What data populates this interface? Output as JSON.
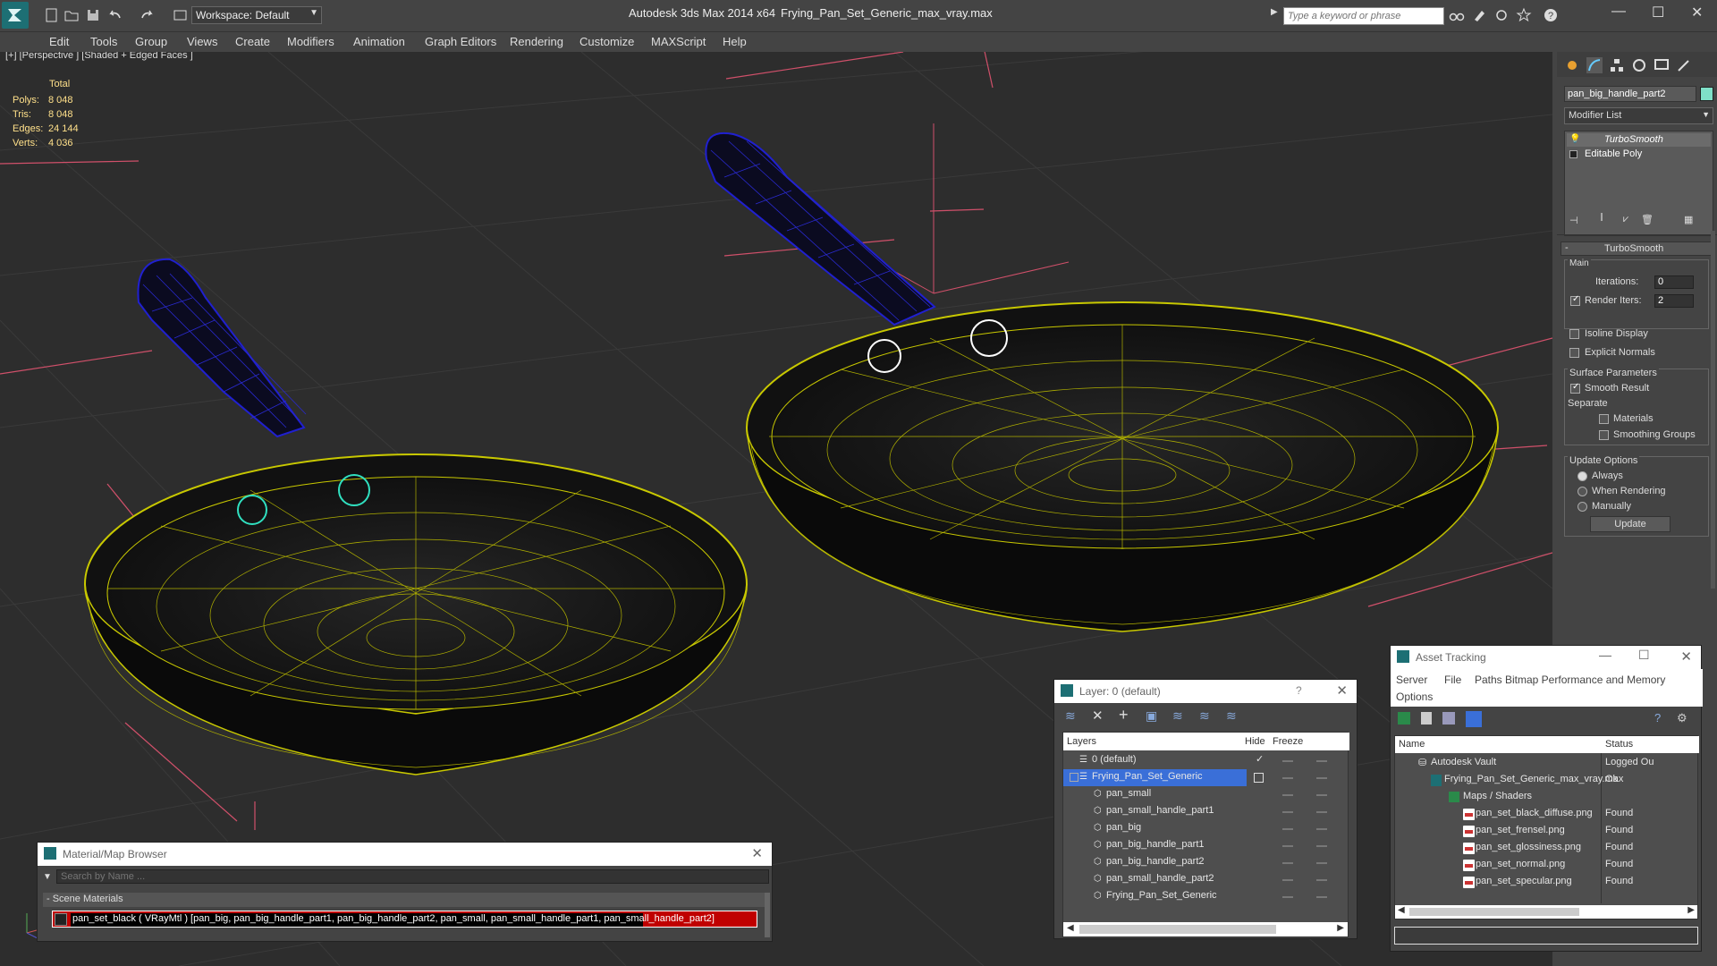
{
  "titlebar": {
    "app_title": "Autodesk 3ds Max  2014 x64",
    "file_name": "Frying_Pan_Set_Generic_max_vray.max",
    "workspace": "Workspace: Default",
    "search_placeholder": "Type a keyword or phrase"
  },
  "menu": [
    "Edit",
    "Tools",
    "Group",
    "Views",
    "Create",
    "Modifiers",
    "Animation",
    "Graph Editors",
    "Rendering",
    "Customize",
    "MAXScript",
    "Help"
  ],
  "viewport": {
    "label": "[+] [Perspective ] [Shaded + Edged Faces ]",
    "stats": {
      "header": "Total",
      "rows": [
        {
          "label": "Polys:",
          "value": "8 048"
        },
        {
          "label": "Tris:",
          "value": "8 048"
        },
        {
          "label": "Edges:",
          "value": "24 144"
        },
        {
          "label": "Verts:",
          "value": "4 036"
        }
      ]
    }
  },
  "command_panel": {
    "object_name": "pan_big_handle_part2",
    "modifier_list": "Modifier List",
    "stack": [
      "TurboSmooth",
      "Editable Poly"
    ],
    "turbosmooth": {
      "rollout_title": "TurboSmooth",
      "main_label": "Main",
      "iterations_label": "Iterations:",
      "iterations_value": "0",
      "render_iters_label": "Render Iters:",
      "render_iters_value": "2",
      "isoline": "Isoline Display",
      "explicit_normals": "Explicit Normals",
      "surface_params": "Surface Parameters",
      "smooth_result": "Smooth Result",
      "separate": "Separate",
      "materials": "Materials",
      "smoothing_groups": "Smoothing Groups",
      "update_options": "Update Options",
      "always": "Always",
      "when_rendering": "When Rendering",
      "manually": "Manually",
      "update_button": "Update"
    }
  },
  "material_browser": {
    "title": "Material/Map Browser",
    "search_placeholder": "Search by Name ...",
    "group": "- Scene Materials",
    "material": "pan_set_black  ( VRayMtl ) [pan_big, pan_big_handle_part1, pan_big_handle_part2, pan_small, pan_small_handle_part1, pan_small_handle_part2]"
  },
  "layer_dialog": {
    "title": "Layer: 0 (default)",
    "help": "?",
    "columns": [
      "Layers",
      "Hide",
      "Freeze"
    ],
    "rows": [
      "0 (default)",
      "Frying_Pan_Set_Generic",
      "pan_small",
      "pan_small_handle_part1",
      "pan_big",
      "pan_big_handle_part1",
      "pan_big_handle_part2",
      "pan_small_handle_part2",
      "Frying_Pan_Set_Generic"
    ]
  },
  "asset_tracking": {
    "title": "Asset Tracking",
    "menu": [
      "Server",
      "File",
      "Paths",
      "Bitmap Performance and Memory",
      "Options"
    ],
    "columns": [
      "Name",
      "Status"
    ],
    "rows": [
      {
        "name": "Autodesk Vault",
        "status": "Logged Ou"
      },
      {
        "name": "Frying_Pan_Set_Generic_max_vray.max",
        "status": "Ok"
      },
      {
        "name": "Maps / Shaders",
        "status": ""
      },
      {
        "name": "pan_set_black_diffuse.png",
        "status": "Found"
      },
      {
        "name": "pan_set_frensel.png",
        "status": "Found"
      },
      {
        "name": "pan_set_glossiness.png",
        "status": "Found"
      },
      {
        "name": "pan_set_normal.png",
        "status": "Found"
      },
      {
        "name": "pan_set_specular.png",
        "status": "Found"
      }
    ]
  },
  "colors": {
    "accent": "#3a6fd8",
    "wire": "#c8c800",
    "handle_wire": "#1a20c8",
    "grid_red": "#d0506a",
    "object_color": "#7fe0c8"
  }
}
